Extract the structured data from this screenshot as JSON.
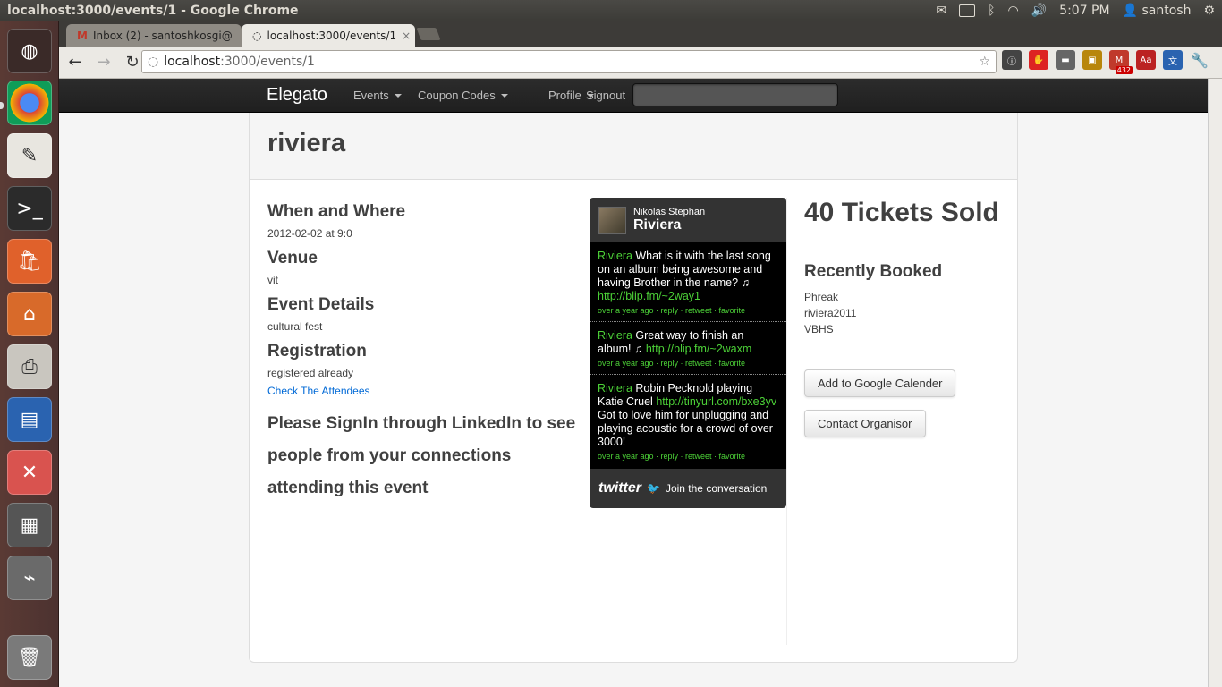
{
  "system": {
    "window_title": "localhost:3000/events/1 - Google Chrome",
    "clock": "5:07 PM",
    "user": "santosh"
  },
  "browser": {
    "tabs": [
      {
        "label": "Inbox (2) - santoshkosgi@"
      },
      {
        "label": "localhost:3000/events/1"
      }
    ],
    "url_host": "localhost",
    "url_path": ":3000/events/1",
    "gmail_badge": "432"
  },
  "nav": {
    "brand": "Elegato",
    "items": [
      {
        "label": "Events"
      },
      {
        "label": "Coupon Codes"
      },
      {
        "label": "Profile"
      }
    ],
    "signout": "Signout",
    "search_placeholder": ""
  },
  "event": {
    "title": "riviera",
    "when_heading": "When and Where",
    "when_value": "2012-02-02 at 9:0",
    "venue_heading": "Venue",
    "venue_value": "vit",
    "details_heading": "Event Details",
    "details_value": "cultural fest",
    "registration_heading": "Registration",
    "registration_value": "registered already",
    "attendees_link": "Check The Attendees",
    "linkedin_message": "Please SignIn through LinkedIn to see people from your connections attending this event"
  },
  "twitter": {
    "user": "Nikolas Stephan",
    "name": "Riviera",
    "tweets": [
      {
        "author": "Riviera",
        "text": " What is it with the last song on an album being awesome and having Brother in the name? ♫ ",
        "link": "http://blip.fm/~2way1",
        "meta": "over a year ago · reply · retweet · favorite"
      },
      {
        "author": "Riviera",
        "text": " Great way to finish an album! ♫ ",
        "link": "http://blip.fm/~2waxm",
        "meta": "over a year ago · reply · retweet · favorite"
      },
      {
        "author": "Riviera",
        "text": " Robin Pecknold playing Katie Cruel ",
        "link": "http://tinyurl.com/bxe3yv",
        "text_after": " Got to love him for unplugging and playing acoustic for a crowd of over 3000!",
        "meta": "over a year ago · reply · retweet · favorite"
      }
    ],
    "footer_logo": "twitter",
    "footer_text": "Join the conversation"
  },
  "sidebar": {
    "tickets_sold": "40 Tickets Sold",
    "recent_heading": "Recently Booked",
    "recent": [
      "Phreak",
      "riviera2011",
      "VBHS"
    ],
    "add_calendar": "Add to Google Calender",
    "contact": "Contact Organisor"
  }
}
